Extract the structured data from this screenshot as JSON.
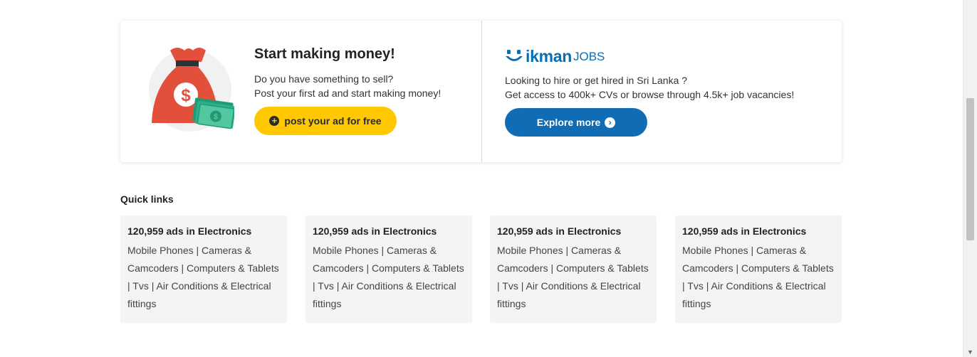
{
  "promo": {
    "money": {
      "title": "Start making money!",
      "line1": "Do you have something to sell?",
      "line2": "Post your first ad and start making money!",
      "button_label": "post your ad for free",
      "button_color": "#ffc800"
    },
    "jobs": {
      "brand": "ikman",
      "brand_suffix": "JOBS",
      "line1": "Looking to hire or get hired in Sri Lanka ?",
      "line2": "Get access to 400k+ CVs or browse through 4.5k+ job vacancies!",
      "button_label": "Explore more",
      "button_color": "#0f6cb5"
    }
  },
  "quick_links": {
    "title": "Quick links",
    "cards": [
      {
        "heading": "120,959 ads in Electronics",
        "links": [
          "Mobile Phones",
          "Cameras & Camcoders",
          "Computers & Tablets",
          "Tvs",
          "Air Conditions & Electrical fittings"
        ]
      },
      {
        "heading": "120,959 ads in Electronics",
        "links": [
          "Mobile Phones",
          "Cameras & Camcoders",
          "Computers & Tablets",
          "Tvs",
          "Air Conditions & Electrical fittings"
        ]
      },
      {
        "heading": "120,959 ads in Electronics",
        "links": [
          "Mobile Phones",
          "Cameras & Camcoders",
          "Computers & Tablets",
          "Tvs",
          "Air Conditions & Electrical fittings"
        ]
      },
      {
        "heading": "120,959 ads in Electronics",
        "links": [
          "Mobile Phones",
          "Cameras & Camcoders",
          "Computers & Tablets",
          "Tvs",
          "Air Conditions & Electrical fittings"
        ]
      }
    ]
  },
  "icons": {
    "money_bag": "money-bag-icon",
    "plus": "plus-circle-icon",
    "chevron": "chevron-right-circle-icon",
    "smile": "smile-logo-icon"
  }
}
